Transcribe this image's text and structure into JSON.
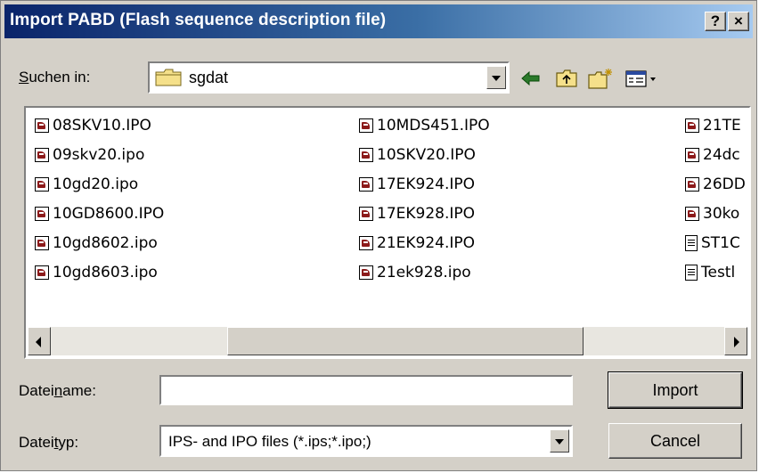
{
  "window": {
    "title": "Import PABD (Flash sequence description file)",
    "help_label": "?",
    "close_label": "×"
  },
  "lookin": {
    "label_pre": "S",
    "label_rest": "uchen in:",
    "folder": "sgdat"
  },
  "files": {
    "col1": [
      "08SKV10.IPO",
      "09skv20.ipo",
      "10gd20.ipo",
      "10GD8600.IPO",
      "10gd8602.ipo",
      "10gd8603.ipo"
    ],
    "col2": [
      "10MDS451.IPO",
      "10SKV20.IPO",
      "17EK924.IPO",
      "17EK928.IPO",
      "21EK924.IPO",
      "21ek928.ipo"
    ],
    "col3": [
      "21TE",
      "24dc",
      "26DD",
      "30ko",
      "ST1C",
      "Testl"
    ],
    "col3_icons": [
      "ipo-icon",
      "ipo-icon",
      "ipo-icon",
      "ipo-icon",
      "txt-icon",
      "txt-icon"
    ]
  },
  "filename": {
    "label_pre": "Datei",
    "label_u": "n",
    "label_post": "ame:",
    "value": ""
  },
  "filetype": {
    "label_pre": "Datei",
    "label_u": "t",
    "label_post": "yp:",
    "value": "IPS- and IPO files (*.ips;*.ipo;)"
  },
  "buttons": {
    "import": "Import",
    "cancel": "Cancel"
  },
  "colors": {
    "title_start": "#0a246a",
    "title_end": "#a6caf0",
    "face": "#d4d0c8"
  }
}
